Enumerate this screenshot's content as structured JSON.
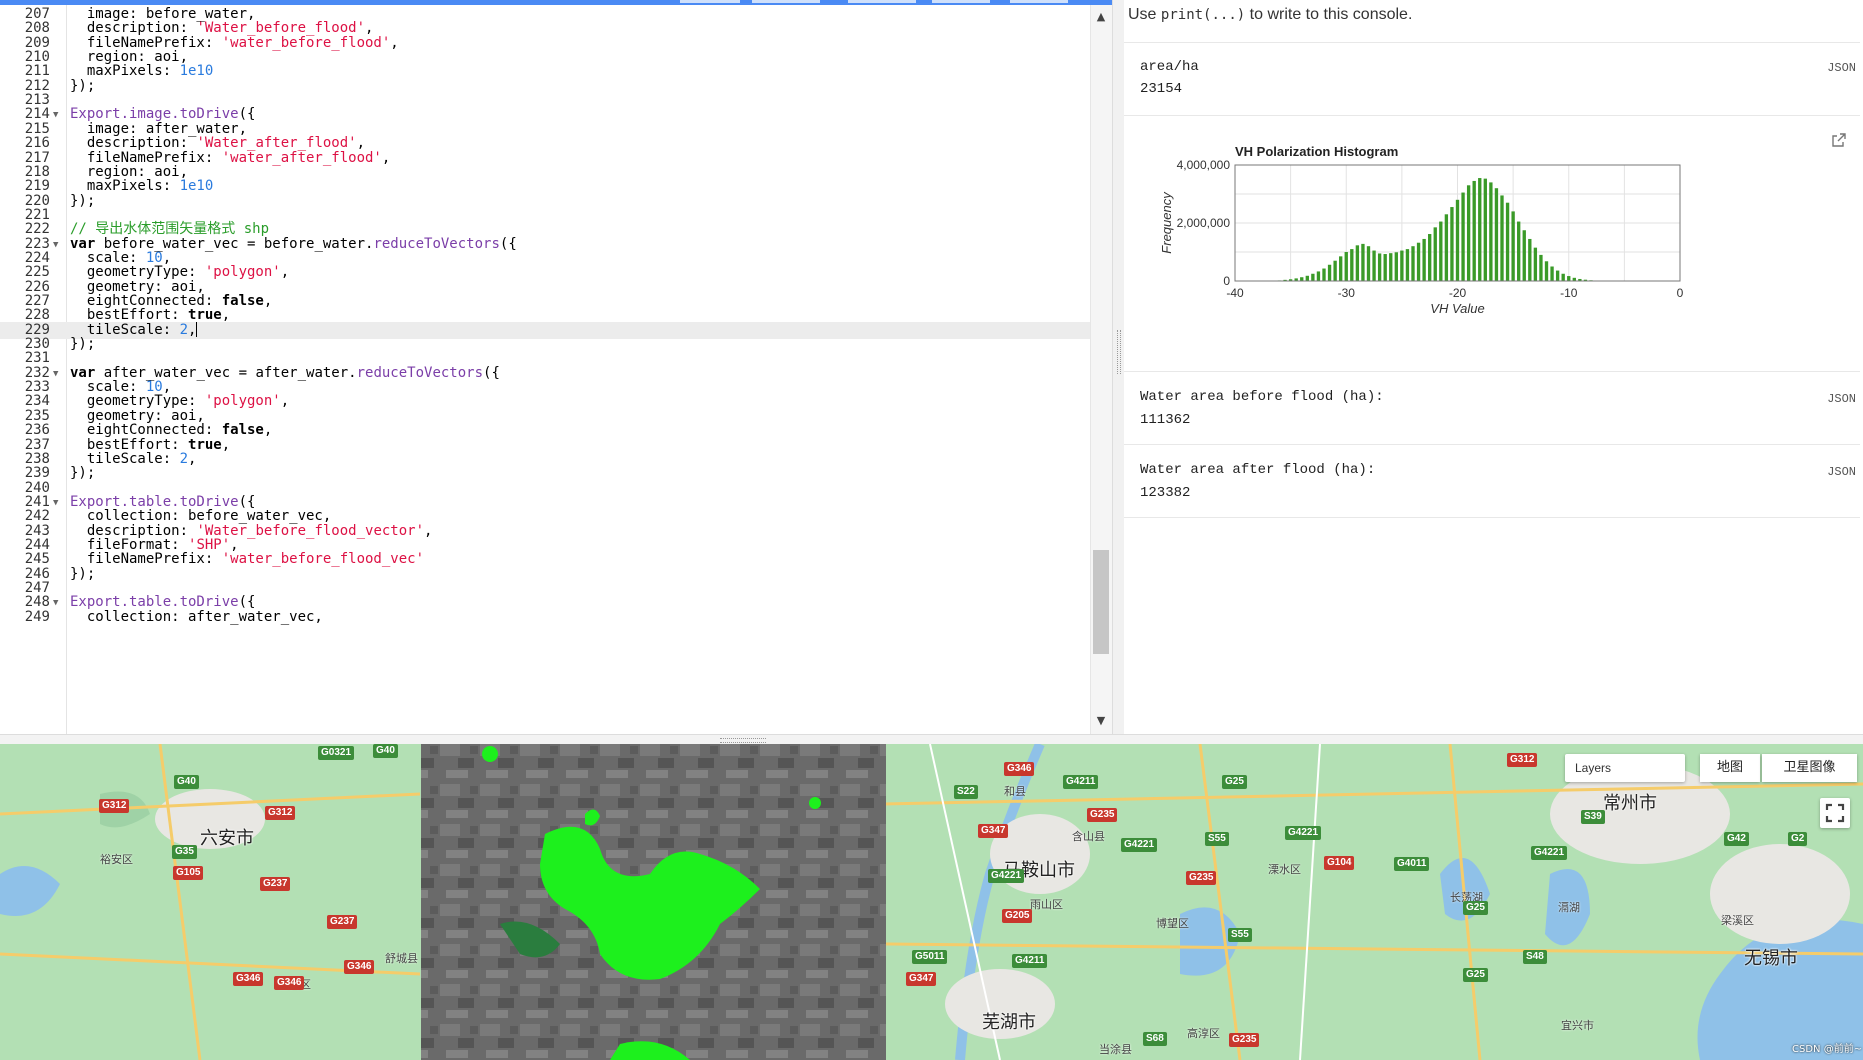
{
  "editor": {
    "lines": [
      {
        "n": "207",
        "fold": false,
        "tokens": [
          [
            "t",
            "  image: before_water,"
          ]
        ]
      },
      {
        "n": "208",
        "fold": false,
        "tokens": [
          [
            "t",
            "  description: "
          ],
          [
            "s",
            "'Water_before_flood'"
          ],
          [
            "t",
            ","
          ]
        ]
      },
      {
        "n": "209",
        "fold": false,
        "tokens": [
          [
            "t",
            "  fileNamePrefix: "
          ],
          [
            "s",
            "'water_before_flood'"
          ],
          [
            "t",
            ","
          ]
        ]
      },
      {
        "n": "210",
        "fold": false,
        "tokens": [
          [
            "t",
            "  region: aoi,"
          ]
        ]
      },
      {
        "n": "211",
        "fold": false,
        "tokens": [
          [
            "t",
            "  maxPixels: "
          ],
          [
            "n",
            "1e10"
          ]
        ]
      },
      {
        "n": "212",
        "fold": false,
        "tokens": [
          [
            "t",
            "});"
          ]
        ]
      },
      {
        "n": "213",
        "fold": false,
        "tokens": []
      },
      {
        "n": "214",
        "fold": true,
        "tokens": [
          [
            "f",
            "Export.image.toDrive"
          ],
          [
            "t",
            "({"
          ]
        ]
      },
      {
        "n": "215",
        "fold": false,
        "tokens": [
          [
            "t",
            "  image: after_water,"
          ]
        ]
      },
      {
        "n": "216",
        "fold": false,
        "tokens": [
          [
            "t",
            "  description: "
          ],
          [
            "s",
            "'Water_after_flood'"
          ],
          [
            "t",
            ","
          ]
        ]
      },
      {
        "n": "217",
        "fold": false,
        "tokens": [
          [
            "t",
            "  fileNamePrefix: "
          ],
          [
            "s",
            "'water_after_flood'"
          ],
          [
            "t",
            ","
          ]
        ]
      },
      {
        "n": "218",
        "fold": false,
        "tokens": [
          [
            "t",
            "  region: aoi,"
          ]
        ]
      },
      {
        "n": "219",
        "fold": false,
        "tokens": [
          [
            "t",
            "  maxPixels: "
          ],
          [
            "n",
            "1e10"
          ]
        ]
      },
      {
        "n": "220",
        "fold": false,
        "tokens": [
          [
            "t",
            "});"
          ]
        ]
      },
      {
        "n": "221",
        "fold": false,
        "tokens": []
      },
      {
        "n": "222",
        "fold": false,
        "tokens": [
          [
            "c",
            "// 导出水体范围矢量格式 shp"
          ]
        ]
      },
      {
        "n": "223",
        "fold": true,
        "tokens": [
          [
            "k",
            "var"
          ],
          [
            "t",
            " before_water_vec = before_water."
          ],
          [
            "f",
            "reduceToVectors"
          ],
          [
            "t",
            "({"
          ]
        ]
      },
      {
        "n": "224",
        "fold": false,
        "tokens": [
          [
            "t",
            "  scale: "
          ],
          [
            "n",
            "10"
          ],
          [
            "t",
            ","
          ]
        ]
      },
      {
        "n": "225",
        "fold": false,
        "tokens": [
          [
            "t",
            "  geometryType: "
          ],
          [
            "s",
            "'polygon'"
          ],
          [
            "t",
            ","
          ]
        ]
      },
      {
        "n": "226",
        "fold": false,
        "tokens": [
          [
            "t",
            "  geometry: aoi,"
          ]
        ]
      },
      {
        "n": "227",
        "fold": false,
        "tokens": [
          [
            "t",
            "  eightConnected: "
          ],
          [
            "k",
            "false"
          ],
          [
            "t",
            ","
          ]
        ]
      },
      {
        "n": "228",
        "fold": false,
        "tokens": [
          [
            "t",
            "  bestEffort: "
          ],
          [
            "k",
            "true"
          ],
          [
            "t",
            ","
          ]
        ]
      },
      {
        "n": "229",
        "fold": false,
        "active": true,
        "tokens": [
          [
            "t",
            "  tileScale: "
          ],
          [
            "n",
            "2"
          ],
          [
            "t",
            ","
          ]
        ]
      },
      {
        "n": "230",
        "fold": false,
        "tokens": [
          [
            "t",
            "});"
          ]
        ]
      },
      {
        "n": "231",
        "fold": false,
        "tokens": []
      },
      {
        "n": "232",
        "fold": true,
        "tokens": [
          [
            "k",
            "var"
          ],
          [
            "t",
            " after_water_vec = after_water."
          ],
          [
            "f",
            "reduceToVectors"
          ],
          [
            "t",
            "({"
          ]
        ]
      },
      {
        "n": "233",
        "fold": false,
        "tokens": [
          [
            "t",
            "  scale: "
          ],
          [
            "n",
            "10"
          ],
          [
            "t",
            ","
          ]
        ]
      },
      {
        "n": "234",
        "fold": false,
        "tokens": [
          [
            "t",
            "  geometryType: "
          ],
          [
            "s",
            "'polygon'"
          ],
          [
            "t",
            ","
          ]
        ]
      },
      {
        "n": "235",
        "fold": false,
        "tokens": [
          [
            "t",
            "  geometry: aoi,"
          ]
        ]
      },
      {
        "n": "236",
        "fold": false,
        "tokens": [
          [
            "t",
            "  eightConnected: "
          ],
          [
            "k",
            "false"
          ],
          [
            "t",
            ","
          ]
        ]
      },
      {
        "n": "237",
        "fold": false,
        "tokens": [
          [
            "t",
            "  bestEffort: "
          ],
          [
            "k",
            "true"
          ],
          [
            "t",
            ","
          ]
        ]
      },
      {
        "n": "238",
        "fold": false,
        "tokens": [
          [
            "t",
            "  tileScale: "
          ],
          [
            "n",
            "2"
          ],
          [
            "t",
            ","
          ]
        ]
      },
      {
        "n": "239",
        "fold": false,
        "tokens": [
          [
            "t",
            "});"
          ]
        ]
      },
      {
        "n": "240",
        "fold": false,
        "tokens": []
      },
      {
        "n": "241",
        "fold": true,
        "tokens": [
          [
            "f",
            "Export.table.toDrive"
          ],
          [
            "t",
            "({"
          ]
        ]
      },
      {
        "n": "242",
        "fold": false,
        "tokens": [
          [
            "t",
            "  collection: before_water_vec,"
          ]
        ]
      },
      {
        "n": "243",
        "fold": false,
        "tokens": [
          [
            "t",
            "  description: "
          ],
          [
            "s",
            "'Water_before_flood_vector'"
          ],
          [
            "t",
            ","
          ]
        ]
      },
      {
        "n": "244",
        "fold": false,
        "tokens": [
          [
            "t",
            "  fileFormat: "
          ],
          [
            "s",
            "'SHP'"
          ],
          [
            "t",
            ","
          ]
        ]
      },
      {
        "n": "245",
        "fold": false,
        "tokens": [
          [
            "t",
            "  fileNamePrefix: "
          ],
          [
            "s",
            "'water_before_flood_vec'"
          ]
        ]
      },
      {
        "n": "246",
        "fold": false,
        "tokens": [
          [
            "t",
            "});"
          ]
        ]
      },
      {
        "n": "247",
        "fold": false,
        "tokens": []
      },
      {
        "n": "248",
        "fold": true,
        "tokens": [
          [
            "f",
            "Export.table.toDrive"
          ],
          [
            "t",
            "({"
          ]
        ]
      },
      {
        "n": "249",
        "fold": false,
        "tokens": [
          [
            "t",
            "  collection: after_water_vec,"
          ]
        ]
      }
    ]
  },
  "console": {
    "hint_pre": "Use ",
    "hint_code": "print(...)",
    "hint_post": " to write to this console.",
    "json_label": "JSON",
    "area_label": "area/ha",
    "area_value": "23154",
    "before_label": "Water area before flood (ha):",
    "before_value": "111362",
    "after_label": "Water area after flood (ha):",
    "after_value": "123382"
  },
  "chart_data": {
    "type": "bar",
    "title": "VH Polarization Histogram",
    "xlabel": "VH Value",
    "ylabel": "Frequency",
    "xlim": [
      -40,
      0
    ],
    "ylim": [
      0,
      4000000
    ],
    "xticks": [
      "-40",
      "-30",
      "-20",
      "-10",
      "0"
    ],
    "yticks": [
      "0",
      "2,000,000",
      "4,000,000"
    ],
    "color": "#3a9a28",
    "bin_width": 0.5,
    "x": [
      -36.0,
      -35.5,
      -35.0,
      -34.5,
      -34.0,
      -33.5,
      -33.0,
      -32.5,
      -32.0,
      -31.5,
      -31.0,
      -30.5,
      -30.0,
      -29.5,
      -29.0,
      -28.5,
      -28.0,
      -27.5,
      -27.0,
      -26.5,
      -26.0,
      -25.5,
      -25.0,
      -24.5,
      -24.0,
      -23.5,
      -23.0,
      -22.5,
      -22.0,
      -21.5,
      -21.0,
      -20.5,
      -20.0,
      -19.5,
      -19.0,
      -18.5,
      -18.0,
      -17.5,
      -17.0,
      -16.5,
      -16.0,
      -15.5,
      -15.0,
      -14.5,
      -14.0,
      -13.5,
      -13.0,
      -12.5,
      -12.0,
      -11.5,
      -11.0,
      -10.5,
      -10.0,
      -9.5,
      -9.0,
      -8.5,
      -8.0,
      -7.5,
      -7.0,
      -6.5
    ],
    "values": [
      20000,
      40000,
      60000,
      90000,
      130000,
      180000,
      250000,
      330000,
      430000,
      560000,
      700000,
      850000,
      1000000,
      1100000,
      1230000,
      1280000,
      1200000,
      1050000,
      950000,
      930000,
      960000,
      990000,
      1050000,
      1100000,
      1200000,
      1320000,
      1450000,
      1620000,
      1850000,
      2050000,
      2300000,
      2550000,
      2800000,
      3050000,
      3300000,
      3450000,
      3550000,
      3530000,
      3400000,
      3200000,
      2950000,
      2700000,
      2400000,
      2050000,
      1750000,
      1450000,
      1150000,
      900000,
      680000,
      500000,
      360000,
      250000,
      170000,
      110000,
      70000,
      45000,
      25000,
      15000,
      8000,
      4000
    ]
  },
  "map": {
    "layers_label": "Layers",
    "map_btn": "地图",
    "sat_btn": "卫星图像",
    "watermark": "CSDN @前前~",
    "big_labels": [
      {
        "id": "luan",
        "text": "六安市"
      },
      {
        "id": "maanshan",
        "text": "马鞍山市"
      },
      {
        "id": "wuhu",
        "text": "芜湖市"
      },
      {
        "id": "changzhou",
        "text": "常州市"
      },
      {
        "id": "wuxi",
        "text": "无锡市"
      }
    ],
    "small_labels": [
      {
        "id": "yuan",
        "text": "裕安区"
      },
      {
        "id": "shucheng",
        "text": "舒城县"
      },
      {
        "id": "jinan",
        "text": "金安区"
      },
      {
        "id": "hexian",
        "text": "和县"
      },
      {
        "id": "hanshan",
        "text": "含山县"
      },
      {
        "id": "yushan",
        "text": "雨山区"
      },
      {
        "id": "lishui",
        "text": "溧水区"
      },
      {
        "id": "bowang",
        "text": "博望区"
      },
      {
        "id": "gaochun",
        "text": "高淳区"
      },
      {
        "id": "dangtu",
        "text": "当涂县"
      },
      {
        "id": "yixing",
        "text": "宜兴市"
      },
      {
        "id": "liangxi",
        "text": "梁溪区"
      },
      {
        "id": "changdang",
        "text": "长荡湖"
      },
      {
        "id": "gehu",
        "text": "滆湖"
      }
    ],
    "shields": [
      {
        "id": "g0321",
        "text": "G0321",
        "c": "g"
      },
      {
        "id": "g40a",
        "text": "G40",
        "c": "g"
      },
      {
        "id": "g40b",
        "text": "G40",
        "c": "g"
      },
      {
        "id": "g312a",
        "text": "G312",
        "c": "r"
      },
      {
        "id": "g312b",
        "text": "G312",
        "c": "r"
      },
      {
        "id": "g35",
        "text": "G35",
        "c": "g"
      },
      {
        "id": "g105",
        "text": "G105",
        "c": "r"
      },
      {
        "id": "g237a",
        "text": "G237",
        "c": "r"
      },
      {
        "id": "g237b",
        "text": "G237",
        "c": "r"
      },
      {
        "id": "g346a",
        "text": "G346",
        "c": "r"
      },
      {
        "id": "g346b",
        "text": "G346",
        "c": "r"
      },
      {
        "id": "g346c",
        "text": "G346",
        "c": "r"
      },
      {
        "id": "s22",
        "text": "S22",
        "c": "g"
      },
      {
        "id": "g346d",
        "text": "G346",
        "c": "r"
      },
      {
        "id": "g4211a",
        "text": "G4211",
        "c": "g"
      },
      {
        "id": "g347a",
        "text": "G347",
        "c": "r"
      },
      {
        "id": "g235a",
        "text": "G235",
        "c": "r"
      },
      {
        "id": "g4221a",
        "text": "G4221",
        "c": "g"
      },
      {
        "id": "g4221b",
        "text": "G4221",
        "c": "g"
      },
      {
        "id": "g205",
        "text": "G205",
        "c": "r"
      },
      {
        "id": "g5011",
        "text": "G5011",
        "c": "g"
      },
      {
        "id": "g4211b",
        "text": "G4211",
        "c": "g"
      },
      {
        "id": "g347b",
        "text": "G347",
        "c": "r"
      },
      {
        "id": "g25a",
        "text": "G25",
        "c": "g"
      },
      {
        "id": "s55a",
        "text": "S55",
        "c": "g"
      },
      {
        "id": "g235b",
        "text": "G235",
        "c": "r"
      },
      {
        "id": "s55b",
        "text": "S55",
        "c": "g"
      },
      {
        "id": "s68",
        "text": "S68",
        "c": "g"
      },
      {
        "id": "g235c",
        "text": "G235",
        "c": "r"
      },
      {
        "id": "g4221c",
        "text": "G4221",
        "c": "g"
      },
      {
        "id": "g104",
        "text": "G104",
        "c": "r"
      },
      {
        "id": "g4011",
        "text": "G4011",
        "c": "g"
      },
      {
        "id": "g312c",
        "text": "G312",
        "c": "r"
      },
      {
        "id": "s39",
        "text": "S39",
        "c": "g"
      },
      {
        "id": "g4221d",
        "text": "G4221",
        "c": "g"
      },
      {
        "id": "g25b",
        "text": "G25",
        "c": "g"
      },
      {
        "id": "s48",
        "text": "S48",
        "c": "g"
      },
      {
        "id": "g25c",
        "text": "G25",
        "c": "g"
      },
      {
        "id": "g42",
        "text": "G42",
        "c": "g"
      },
      {
        "id": "g2",
        "text": "G2",
        "c": "g"
      }
    ]
  }
}
